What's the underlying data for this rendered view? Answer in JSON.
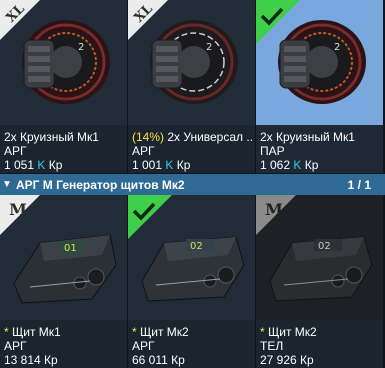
{
  "top_cards": [
    {
      "badge": "XL",
      "line1_prefix": "",
      "line1": "2x Круизный Мк1",
      "line2": "АРГ",
      "price_num": "1 051",
      "price_k": "K",
      "price_unit": "Кр"
    },
    {
      "badge": "XL",
      "line1_prefix": "(14%)",
      "line1": " 2x Универсал ...",
      "line2": "АРГ",
      "price_num": "1 001",
      "price_k": "K",
      "price_unit": "Кр"
    },
    {
      "badge": "check",
      "line1_prefix": "",
      "line1": "2x Круизный Мк1",
      "line2": "ПАР",
      "price_num": "1 062",
      "price_k": "K",
      "price_unit": "Кр"
    }
  ],
  "section": {
    "arrow": "▼",
    "title": "АРГ М Генератор щитов Мк2",
    "page": "1 / 1"
  },
  "bottom_cards": [
    {
      "badge": "M",
      "star": "*",
      "line1": " Щит Мк1",
      "line2": "АРГ",
      "price": "13 814 Кр"
    },
    {
      "badge": "check",
      "star": "*",
      "line1": " Щит Мк2",
      "line2": "АРГ",
      "price": "66 011 Кр"
    },
    {
      "badge": "M",
      "star": "*",
      "line1": " Щит Мк2",
      "line2": "ТЕЛ",
      "price": "27 926 Кр"
    }
  ],
  "colors": {
    "accent_blue": "#2f6a95",
    "check_green": "#3fcf4a",
    "star_yellow": "#f5e04a",
    "k_cyan": "#38c8e8"
  }
}
